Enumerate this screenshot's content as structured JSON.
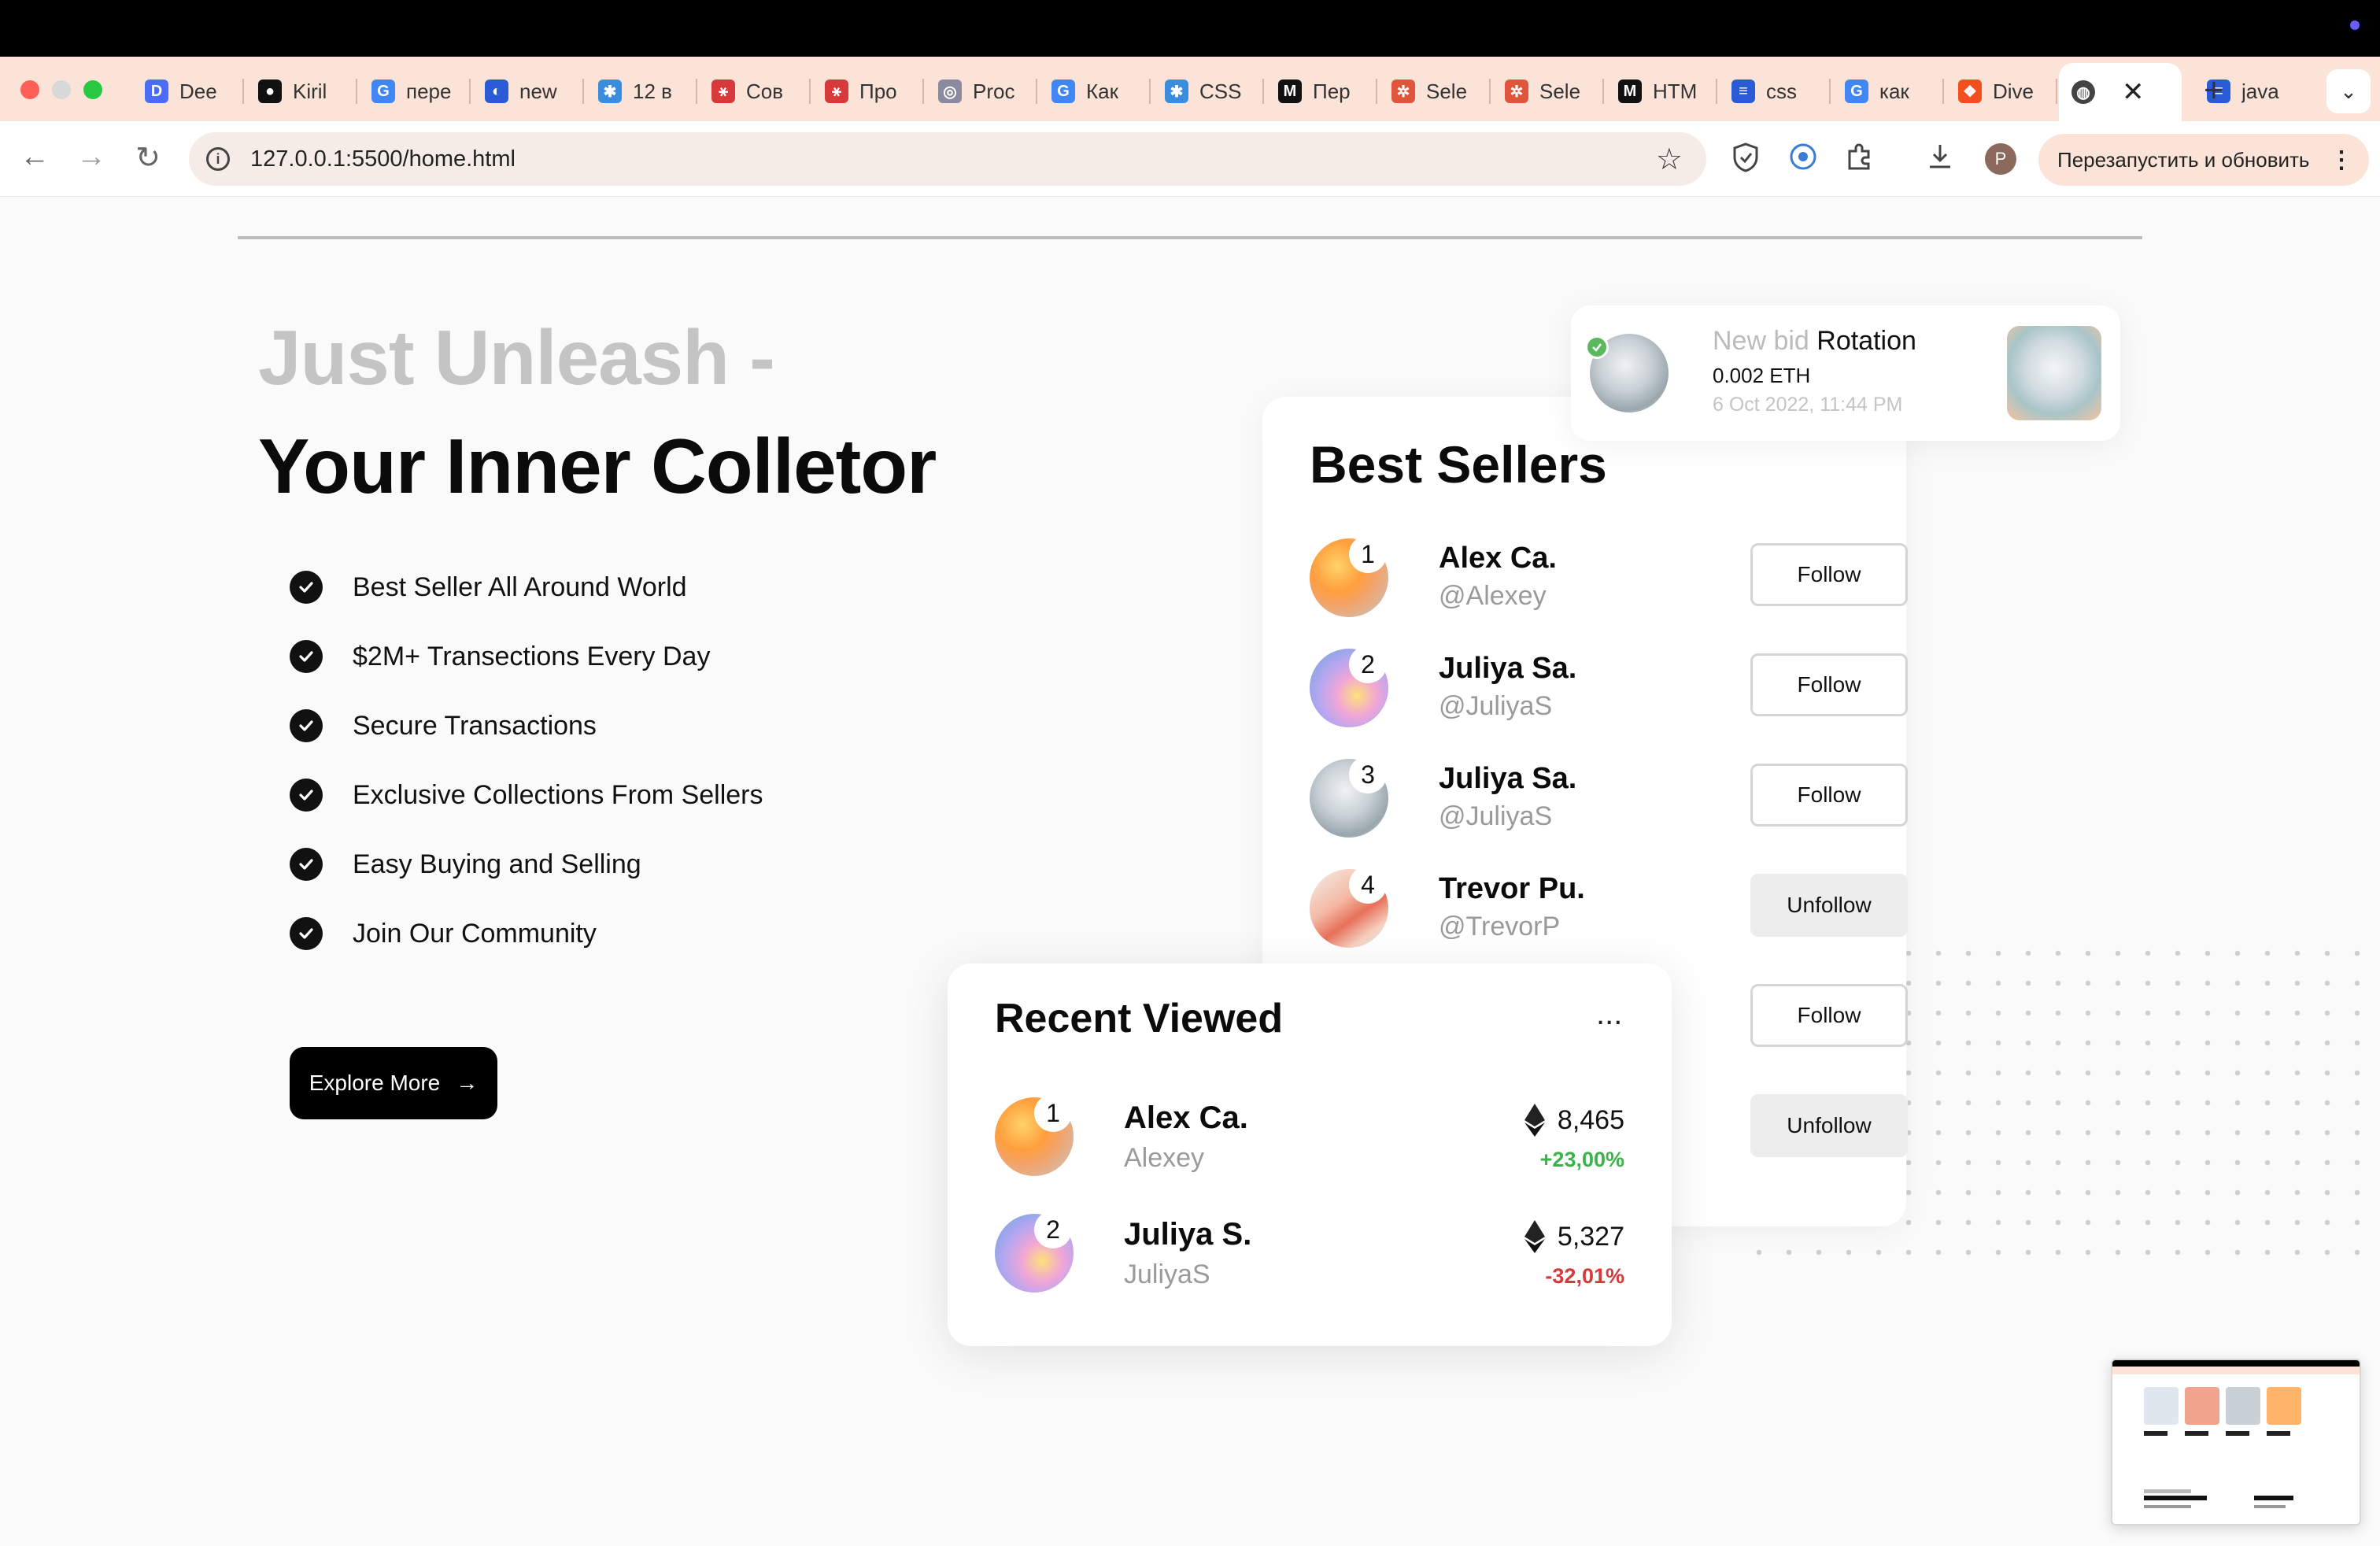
{
  "browser": {
    "tabs": [
      {
        "label": "Dee",
        "color": "#4a6cf7",
        "glyph": "D"
      },
      {
        "label": "Kiril",
        "color": "#111111",
        "glyph": "●"
      },
      {
        "label": "пере",
        "color": "#4285f4",
        "glyph": "G"
      },
      {
        "label": "new",
        "color": "#2a5bd7",
        "glyph": "◐"
      },
      {
        "label": "12 в",
        "color": "#3a8dde",
        "glyph": "✱"
      },
      {
        "label": "Сов",
        "color": "#d8393a",
        "glyph": "⚹"
      },
      {
        "label": "Про",
        "color": "#d8393a",
        "glyph": "⚹"
      },
      {
        "label": "Proc",
        "color": "#8a8aa0",
        "glyph": "◎"
      },
      {
        "label": "Как",
        "color": "#4285f4",
        "glyph": "G"
      },
      {
        "label": "CSS",
        "color": "#3a8dde",
        "glyph": "✱"
      },
      {
        "label": "Пер",
        "color": "#111111",
        "glyph": "M"
      },
      {
        "label": "Sele",
        "color": "#e2553d",
        "glyph": "✲"
      },
      {
        "label": "Sele",
        "color": "#e2553d",
        "glyph": "✲"
      },
      {
        "label": "HTM",
        "color": "#111111",
        "glyph": "M"
      },
      {
        "label": "css",
        "color": "#2a5bd7",
        "glyph": "≡"
      },
      {
        "label": "как",
        "color": "#4285f4",
        "glyph": "G"
      },
      {
        "label": "Dive",
        "color": "#f24e1e",
        "glyph": "❖"
      },
      {
        "label": "java",
        "color": "#2a5bd7",
        "glyph": "≡"
      }
    ],
    "url": "127.0.0.1:5500/home.html",
    "profile_initial": "P",
    "restart_label": "Перезапустить и обновить"
  },
  "hero": {
    "subtitle": "Just Unleash -",
    "title": "Your Inner Colletor",
    "features": [
      "Best Seller All Around World",
      "$2M+ Transections Every Day",
      "Secure Transactions",
      "Exclusive Collections From Sellers",
      "Easy Buying and Selling",
      "Join Our Community"
    ],
    "cta_label": "Explore More",
    "cta_arrow": "→"
  },
  "new_bid": {
    "prefix": "New bid",
    "item": "Rotation",
    "price": "0.002 ETH",
    "date": "6 Oct 2022, 11:44 PM"
  },
  "best_sellers": {
    "title": "Best Sellers",
    "sellers": [
      {
        "rank": "1",
        "name": "Alex Ca.",
        "handle": "@Alexey",
        "action": "Follow",
        "avatar": "orange"
      },
      {
        "rank": "2",
        "name": "Juliya Sa.",
        "handle": "@JuliyaS",
        "action": "Follow",
        "avatar": "holo"
      },
      {
        "rank": "3",
        "name": "Juliya Sa.",
        "handle": "@JuliyaS",
        "action": "Follow",
        "avatar": "silver"
      },
      {
        "rank": "4",
        "name": "Trevor Pu.",
        "handle": "@TrevorP",
        "action": "Unfollow",
        "avatar": "coral"
      },
      {
        "rank": "",
        "name": "",
        "handle": "",
        "action": "Follow",
        "avatar": "none"
      },
      {
        "rank": "",
        "name": "",
        "handle": "",
        "action": "Unfollow",
        "avatar": "none"
      }
    ]
  },
  "recent_viewed": {
    "title": "Recent Viewed",
    "more": "...",
    "items": [
      {
        "rank": "1",
        "name": "Alex Ca.",
        "sub": "Alexey",
        "value": "8,465",
        "change": "+23,00%",
        "trend": "up",
        "avatar": "orange"
      },
      {
        "rank": "2",
        "name": "Juliya S.",
        "sub": "JuliyaS",
        "value": "5,327",
        "change": "-32,01%",
        "trend": "down",
        "avatar": "holo"
      }
    ]
  },
  "colors": {
    "accent": "#000000",
    "positive": "#3bb34a",
    "negative": "#d8393a",
    "muted": "#c4c4c4"
  }
}
